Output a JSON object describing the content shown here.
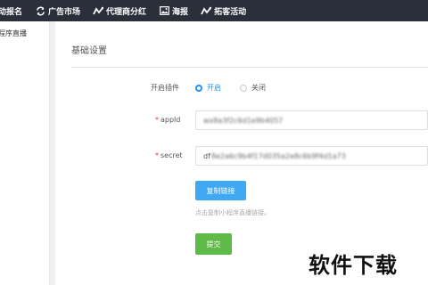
{
  "topnav": {
    "items": [
      {
        "label": "动报名",
        "icon": "partial-icon"
      },
      {
        "label": "广告市场",
        "icon": "refresh-icon"
      },
      {
        "label": "代理商分红",
        "icon": "share-icon"
      },
      {
        "label": "海报",
        "icon": "image-icon"
      },
      {
        "label": "拓客活动",
        "icon": "share-icon"
      }
    ]
  },
  "sidebar": {
    "items": [
      {
        "label": "程序直播"
      }
    ]
  },
  "panel": {
    "title": "基础设置",
    "plugin_switch": {
      "label": "开启插件",
      "options": [
        {
          "label": "开启",
          "checked": true
        },
        {
          "label": "关闭",
          "checked": false
        }
      ]
    },
    "appid": {
      "label": "appId",
      "required_mark": "*",
      "value": "wx8a3f2c6d1e9b4057"
    },
    "secret": {
      "label": "secret",
      "required_mark": "*",
      "prefix": "df",
      "value": "8e2a6c9b4f17d035a2e8c6b9f4d1a73"
    },
    "copy_button": "复制链接",
    "hint": "点击复制小程序直播链接。",
    "submit_button": "提交"
  },
  "watermark": "软件下载",
  "colors": {
    "nav_bg": "#2b2f3a",
    "primary": "#1e90ff",
    "copy_btn": "#40a9f3",
    "submit_btn": "#5fba48",
    "required": "#e4393c"
  }
}
